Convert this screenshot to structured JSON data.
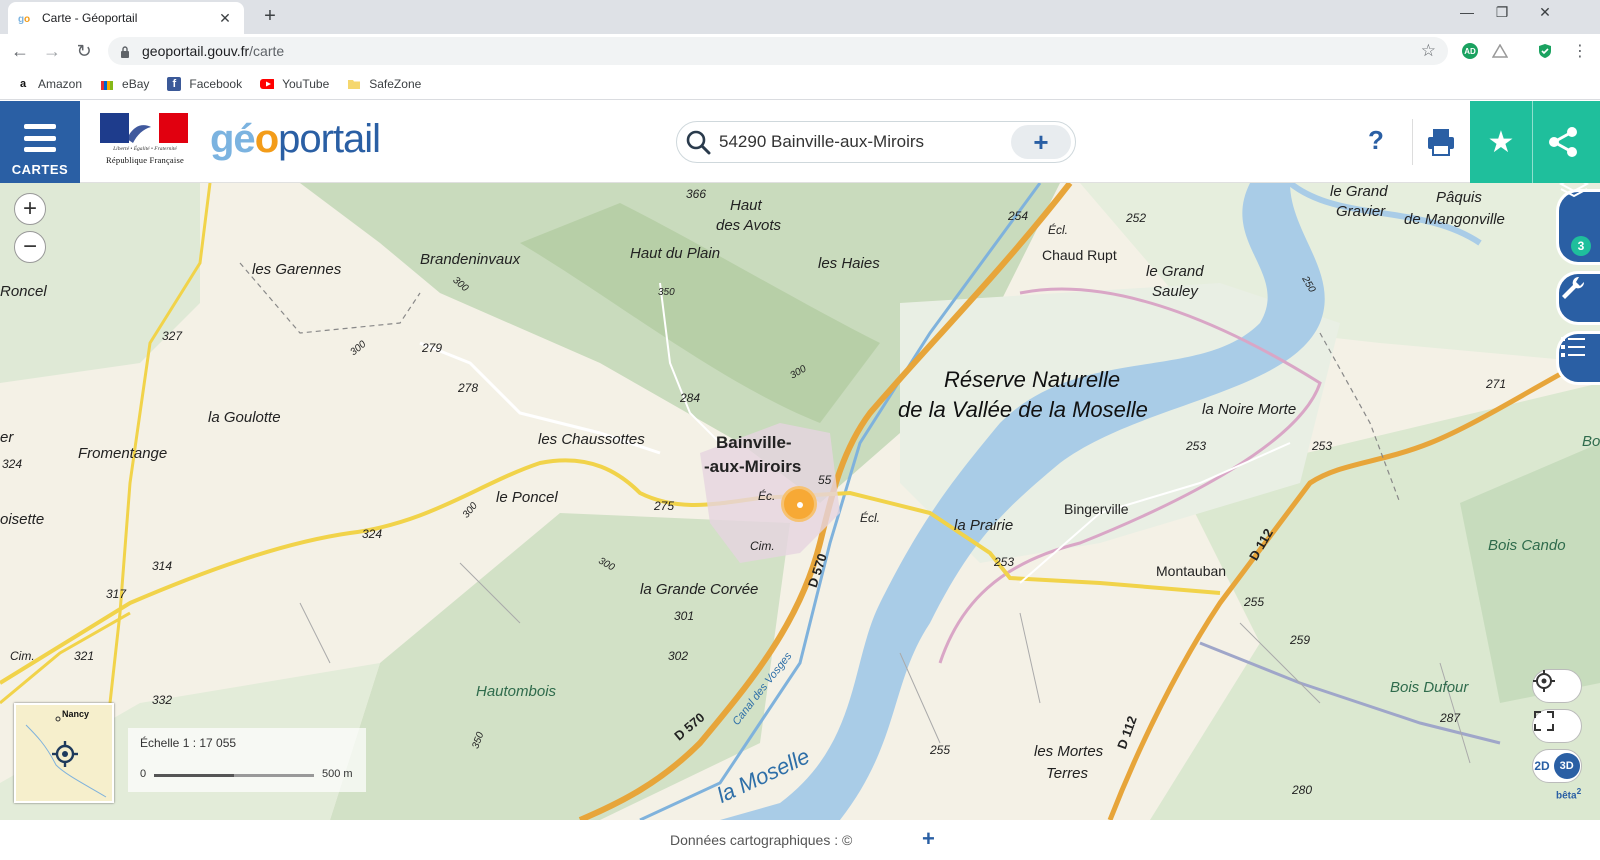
{
  "browser": {
    "tab_title": "Carte - Géoportail",
    "url_host": "geoportail.gouv.fr",
    "url_path": "/carte",
    "bookmarks": [
      {
        "label": "Amazon",
        "icon": "amazon-icon"
      },
      {
        "label": "eBay",
        "icon": "ebay-icon"
      },
      {
        "label": "Facebook",
        "icon": "facebook-icon"
      },
      {
        "label": "YouTube",
        "icon": "youtube-icon"
      },
      {
        "label": "SafeZone",
        "icon": "folder-icon"
      }
    ],
    "ext_badge": "AD"
  },
  "header": {
    "menu_label": "CARTES",
    "rf_motto": "Liberté • Égalité • Fraternité",
    "rf_name": "République Française",
    "logo_geo_1": "gé",
    "logo_geo_2": "o",
    "logo_portail": "portail",
    "search_value": "54290 Bainville-aux-Miroirs",
    "help_label": "?",
    "colors": {
      "primary": "#2a5fa4",
      "accent": "#1fbf9c",
      "logo_orange": "#f39c19"
    }
  },
  "map": {
    "layer_count": "3",
    "zoom_in": "+",
    "zoom_out": "−",
    "mode_2d": "2D",
    "mode_3d": "3D",
    "mode_beta": "bêta",
    "minimap_label": "Nancy",
    "scale_text": "Échelle 1 : 17 055",
    "scale_start": "0",
    "scale_end": "500 m",
    "labels": {
      "haut_avots": "Haut",
      "haut_avots2": "des Avots",
      "haut_plain": "Haut du Plain",
      "les_haies": "les Haies",
      "brandeninvaux": "Brandeninvaux",
      "garennes": "les Garennes",
      "roncel": "Roncel",
      "goulotte": "la Goulotte",
      "fromentange": "Fromentange",
      "chaussottes": "les Chaussottes",
      "bainville1": "Bainville-",
      "bainville2": "-aux-Miroirs",
      "poncel": "le Poncel",
      "grande_corvee": "la Grande Corvée",
      "hautombois": "Hautombois",
      "reserve1": "Réserve Naturelle",
      "reserve2": "de la Vallée de la Moselle",
      "noire_morte": "la Noire Morte",
      "prairie": "la Prairie",
      "bingerville": "Bingerville",
      "montauban": "Montauban",
      "bois_cando": "Bois Cando",
      "bois_dufour": "Bois Dufour",
      "mortes_terres1": "les Mortes",
      "mortes_terres2": "Terres",
      "chaud_rupt": "Chaud Rupt",
      "grand_sauley1": "le Grand",
      "grand_sauley2": "Sauley",
      "grand_gravier1": "le Grand",
      "grand_gravier2": "Gravier",
      "paquis1": "Pâquis",
      "paquis2": "de Mangonville",
      "moselle": "la Moselle",
      "canal": "Canal des Vosges",
      "oisette": "oisette",
      "d570a": "D 570",
      "d570b": "D 570",
      "d112a": "D 112",
      "d112b": "D 112",
      "ec1": "Éc.",
      "ec2": "Écl.",
      "ec3": "Écl.",
      "cim1": "Cim.",
      "cim2": "Cim.",
      "bo": "Bo",
      "er": "er",
      "n366": "366",
      "n254": "254",
      "n252": "252",
      "n327": "327",
      "n279": "279",
      "n278": "278",
      "n284": "284",
      "n350": "350",
      "n300a": "300",
      "n300b": "300",
      "n300c": "300",
      "n300d": "300",
      "n300e": "300",
      "n324a": "324",
      "n324b": "324",
      "n314": "314",
      "n317": "317",
      "n321": "321",
      "n332": "332",
      "n275": "275",
      "n255a": "55",
      "n301": "301",
      "n302": "302",
      "n253a": "253",
      "n253b": "253",
      "n253c": "253",
      "n255b": "255",
      "n255c": "255",
      "n259": "259",
      "n287": "287",
      "n280": "280",
      "n271": "271",
      "n250": "250",
      "n350b": "350"
    }
  },
  "footer": {
    "credits": "Données cartographiques : ©",
    "plus": "+"
  }
}
